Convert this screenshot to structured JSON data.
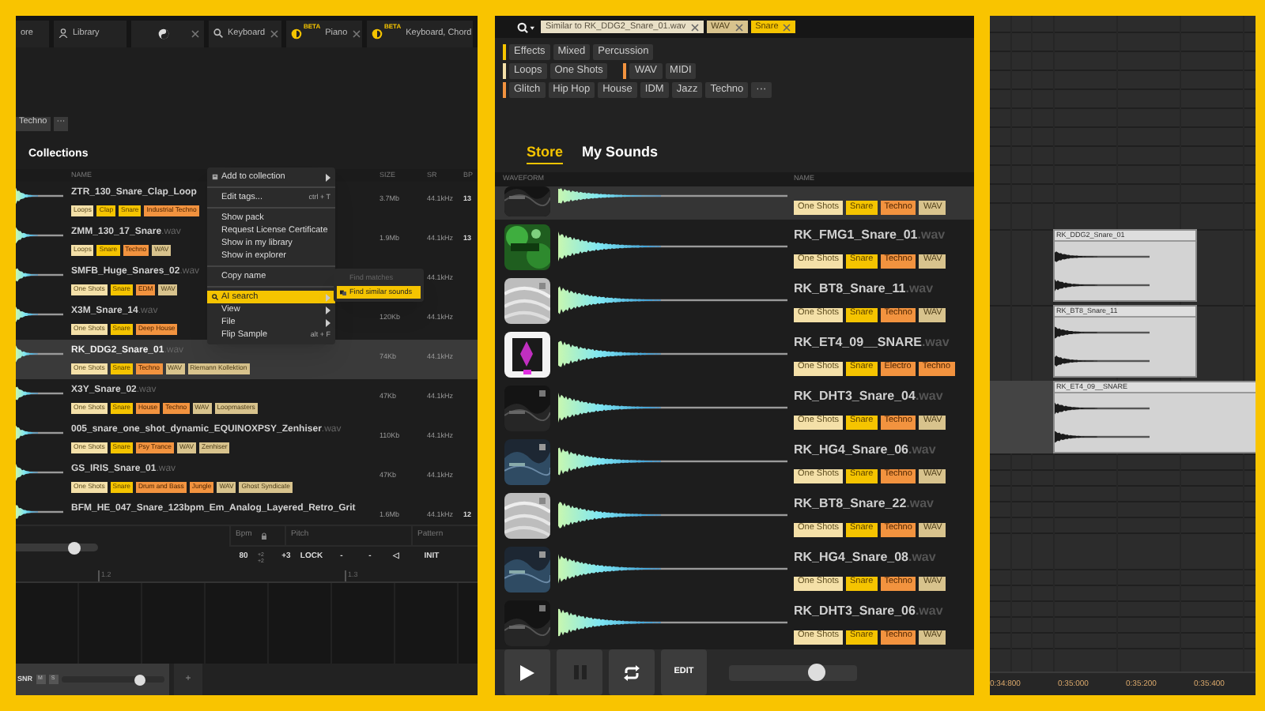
{
  "library_panel": {
    "tabs": [
      {
        "label": "ore",
        "closable": false
      },
      {
        "label": "Library",
        "closable": false
      },
      {
        "closable": true
      },
      {
        "label": "Keyboard",
        "closable": true
      },
      {
        "badge": "BETA",
        "label": "Piano",
        "closable": true
      },
      {
        "badge": "BETA",
        "label": "Keyboard, Chord"
      }
    ],
    "filter_tags": [
      "Techno",
      "···"
    ],
    "heading": "Collections",
    "columns": [
      "NAME",
      "SIZE",
      "SR",
      "BP"
    ],
    "rows": [
      {
        "name": "ZTR_130_Snare_Clap_Loop",
        "selected": false,
        "size": "3.7Mb",
        "sr": "44.1kHz",
        "bpm": "13",
        "tags": [
          {
            "label": "Loops",
            "kind": "type"
          },
          {
            "label": "Clap",
            "kind": "instrument"
          },
          {
            "label": "Snare",
            "kind": "instrument"
          },
          {
            "label": "Industrial Techno",
            "kind": "genre"
          }
        ]
      },
      {
        "name": "ZMM_130_17_Snare",
        "ext": ".wav",
        "selected": false,
        "size": "1.9Mb",
        "sr": "44.1kHz",
        "bpm": "13",
        "tags": [
          {
            "label": "Loops",
            "kind": "type"
          },
          {
            "label": "Snare",
            "kind": "instrument"
          },
          {
            "label": "Techno",
            "kind": "genre"
          },
          {
            "label": "WAV",
            "kind": "meta"
          }
        ]
      },
      {
        "name": "SMFB_Huge_Snares_02",
        "ext": ".wav",
        "selected": false,
        "sr": "44.1kHz",
        "tags": [
          {
            "label": "One Shots",
            "kind": "type"
          },
          {
            "label": "Snare",
            "kind": "instrument"
          },
          {
            "label": "EDM",
            "kind": "genre"
          },
          {
            "label": "WAV",
            "kind": "meta"
          }
        ]
      },
      {
        "name": "X3M_Snare_14",
        "ext": ".wav",
        "selected": false,
        "size": "120Kb",
        "sr": "44.1kHz",
        "tags": [
          {
            "label": "One Shots",
            "kind": "type"
          },
          {
            "label": "Snare",
            "kind": "instrument"
          },
          {
            "label": "Deep House",
            "kind": "genre"
          }
        ]
      },
      {
        "name": "RK_DDG2_Snare_01",
        "ext": ".wav",
        "selected": true,
        "size": "74Kb",
        "sr": "44.1kHz",
        "tags": [
          {
            "label": "One Shots",
            "kind": "type"
          },
          {
            "label": "Snare",
            "kind": "instrument"
          },
          {
            "label": "Techno",
            "kind": "genre"
          },
          {
            "label": "WAV",
            "kind": "meta"
          },
          {
            "label": "Riemann Kollektion",
            "kind": "meta"
          }
        ]
      },
      {
        "name": "X3Y_Snare_02",
        "ext": ".wav",
        "selected": false,
        "size": "47Kb",
        "sr": "44.1kHz",
        "tags": [
          {
            "label": "One Shots",
            "kind": "type"
          },
          {
            "label": "Snare",
            "kind": "instrument"
          },
          {
            "label": "House",
            "kind": "genre"
          },
          {
            "label": "Techno",
            "kind": "genre"
          },
          {
            "label": "WAV",
            "kind": "meta"
          },
          {
            "label": "Loopmasters",
            "kind": "meta"
          }
        ]
      },
      {
        "name": "005_snare_one_shot_dynamic_EQUINOXPSY_Zenhiser",
        "ext": ".wav",
        "selected": false,
        "size": "110Kb",
        "sr": "44.1kHz",
        "tags": [
          {
            "label": "One Shots",
            "kind": "type"
          },
          {
            "label": "Snare",
            "kind": "instrument"
          },
          {
            "label": "Psy Trance",
            "kind": "genre"
          },
          {
            "label": "WAV",
            "kind": "meta"
          },
          {
            "label": "Zenhiser",
            "kind": "meta"
          }
        ]
      },
      {
        "name": "GS_IRIS_Snare_01",
        "ext": ".wav",
        "selected": false,
        "size": "47Kb",
        "sr": "44.1kHz",
        "tags": [
          {
            "label": "One Shots",
            "kind": "type"
          },
          {
            "label": "Snare",
            "kind": "instrument"
          },
          {
            "label": "Drum and Bass",
            "kind": "genre"
          },
          {
            "label": "Jungle",
            "kind": "genre"
          },
          {
            "label": "WAV",
            "kind": "meta"
          },
          {
            "label": "Ghost Syndicate",
            "kind": "meta"
          }
        ]
      },
      {
        "name": "BFM_HE_047_Snare_123bpm_Em_Analog_Layered_Retro_Grit",
        "selected": false,
        "size": "1.6Mb",
        "sr": "44.1kHz",
        "bpm": "12"
      }
    ],
    "context_menu": [
      {
        "kind": "item",
        "label": "Add to collection",
        "submenu": true,
        "highlighted": false
      },
      {
        "kind": "separator"
      },
      {
        "kind": "item",
        "label": "Edit tags...",
        "shortcut": "ctrl + T",
        "submenu": false,
        "highlighted": false
      },
      {
        "kind": "separator"
      },
      {
        "kind": "item",
        "label": "Show pack",
        "submenu": false,
        "highlighted": false
      },
      {
        "kind": "item",
        "label": "Request License Certificate",
        "submenu": false,
        "highlighted": false
      },
      {
        "kind": "item",
        "label": "Show in my library",
        "submenu": false,
        "highlighted": false
      },
      {
        "kind": "item",
        "label": "Show in explorer",
        "submenu": false,
        "highlighted": false
      },
      {
        "kind": "separator"
      },
      {
        "kind": "item",
        "label": "Copy name",
        "submenu": false,
        "highlighted": false
      },
      {
        "kind": "separator"
      },
      {
        "kind": "item",
        "label": "AI search",
        "submenu": true,
        "highlighted": true,
        "open_submenu": [
          {
            "label": "Find matches",
            "disabled": true,
            "highlighted": false
          },
          {
            "label": "Find similar sounds",
            "disabled": false,
            "highlighted": true
          }
        ]
      },
      {
        "kind": "item",
        "label": "View",
        "submenu": true,
        "highlighted": false
      },
      {
        "kind": "item",
        "label": "File",
        "submenu": true,
        "highlighted": false
      },
      {
        "kind": "item",
        "label": "Flip Sample",
        "shortcut": "alt + F",
        "submenu": false,
        "highlighted": false
      }
    ],
    "playback": {
      "slider": {
        "level": 0.72
      },
      "headers": [
        {
          "label": "Bpm"
        },
        {
          "label": "Pitch"
        },
        {
          "label": "Pattern"
        }
      ],
      "bpm": "80",
      "pitch_steps": [
        "+2",
        "+2"
      ],
      "pitch": "+3",
      "buttons": [
        "LOCK",
        "-",
        "-",
        "◁",
        "INIT"
      ]
    },
    "ruler": [
      "1.2",
      "1.3"
    ],
    "track": {
      "name": "SNR",
      "buttons": [
        "M",
        "S"
      ],
      "level": 0.76
    },
    "add_button": "+"
  },
  "browser_panel": {
    "search_chips": [
      {
        "label": "Similar to RK_DDG2_Snare_01.wav",
        "kind": "similar"
      },
      {
        "label": "WAV",
        "kind": "meta"
      },
      {
        "label": "Snare",
        "kind": "instrument"
      }
    ],
    "filter_rows": [
      [
        {
          "color": "#f5c400",
          "items": [
            "Effects",
            "Mixed",
            "Percussion"
          ]
        }
      ],
      [
        {
          "color": "#f4e0a8",
          "items": [
            "Loops",
            "One Shots"
          ]
        },
        {
          "color": "#f2933f",
          "items": [
            "WAV",
            "MIDI"
          ]
        }
      ],
      [
        {
          "color": "#f2933f",
          "items": [
            "Glitch",
            "Hip Hop",
            "House",
            "IDM",
            "Jazz",
            "Techno",
            "···"
          ]
        }
      ]
    ],
    "tabs": [
      {
        "label": "Store",
        "selected": true
      },
      {
        "label": "My Sounds",
        "selected": false
      }
    ],
    "columns": [
      "WAVEFORM",
      "NAME"
    ],
    "rows": [
      {
        "selected": true,
        "tags": [
          {
            "label": "One Shots",
            "kind": "type"
          },
          {
            "label": "Snare",
            "kind": "instrument"
          },
          {
            "label": "Techno",
            "kind": "genre"
          },
          {
            "label": "WAV",
            "kind": "meta"
          }
        ]
      },
      {
        "name": "RK_FMG1_Snare_01",
        "ext": ".wav",
        "selected": false,
        "tags": [
          {
            "label": "One Shots",
            "kind": "type"
          },
          {
            "label": "Snare",
            "kind": "instrument"
          },
          {
            "label": "Techno",
            "kind": "genre"
          },
          {
            "label": "WAV",
            "kind": "meta"
          }
        ]
      },
      {
        "name": "RK_BT8_Snare_11",
        "ext": ".wav",
        "selected": false,
        "tags": [
          {
            "label": "One Shots",
            "kind": "type"
          },
          {
            "label": "Snare",
            "kind": "instrument"
          },
          {
            "label": "Techno",
            "kind": "genre"
          },
          {
            "label": "WAV",
            "kind": "meta"
          }
        ]
      },
      {
        "name": "RK_ET4_09__SNARE",
        "ext": ".wav",
        "selected": false,
        "tags": [
          {
            "label": "One Shots",
            "kind": "type"
          },
          {
            "label": "Snare",
            "kind": "instrument"
          },
          {
            "label": "Electro",
            "kind": "genre"
          },
          {
            "label": "Techno",
            "kind": "genre"
          }
        ]
      },
      {
        "name": "RK_DHT3_Snare_04",
        "ext": ".wav",
        "selected": false,
        "tags": [
          {
            "label": "One Shots",
            "kind": "type"
          },
          {
            "label": "Snare",
            "kind": "instrument"
          },
          {
            "label": "Techno",
            "kind": "genre"
          },
          {
            "label": "WAV",
            "kind": "meta"
          }
        ]
      },
      {
        "name": "RK_HG4_Snare_06",
        "ext": ".wav",
        "selected": false,
        "tags": [
          {
            "label": "One Shots",
            "kind": "type"
          },
          {
            "label": "Snare",
            "kind": "instrument"
          },
          {
            "label": "Techno",
            "kind": "genre"
          },
          {
            "label": "WAV",
            "kind": "meta"
          }
        ]
      },
      {
        "name": "RK_BT8_Snare_22",
        "ext": ".wav",
        "selected": false,
        "tags": [
          {
            "label": "One Shots",
            "kind": "type"
          },
          {
            "label": "Snare",
            "kind": "instrument"
          },
          {
            "label": "Techno",
            "kind": "genre"
          },
          {
            "label": "WAV",
            "kind": "meta"
          }
        ]
      },
      {
        "name": "RK_HG4_Snare_08",
        "ext": ".wav",
        "selected": false,
        "tags": [
          {
            "label": "One Shots",
            "kind": "type"
          },
          {
            "label": "Snare",
            "kind": "instrument"
          },
          {
            "label": "Techno",
            "kind": "genre"
          },
          {
            "label": "WAV",
            "kind": "meta"
          }
        ]
      },
      {
        "name": "RK_DHT3_Snare_06",
        "ext": ".wav",
        "selected": false,
        "tags": [
          {
            "label": "One Shots",
            "kind": "type"
          },
          {
            "label": "Snare",
            "kind": "instrument"
          },
          {
            "label": "Techno",
            "kind": "genre"
          },
          {
            "label": "WAV",
            "kind": "meta"
          }
        ]
      }
    ],
    "transport": {
      "buttons": [
        {
          "kind": "play"
        },
        {
          "kind": "pause"
        },
        {
          "kind": "loop"
        },
        {
          "kind": "text",
          "label": "EDIT"
        }
      ],
      "volume": {
        "level": 0.68
      }
    }
  },
  "arrangement_panel": {
    "clips": [
      {
        "label": "RK_DDG2_Snare_01"
      },
      {
        "label": "RK_BT8_Snare_11"
      },
      {
        "label": "RK_ET4_09__SNARE"
      }
    ],
    "ruler": [
      "0:34:800",
      "0:35:000",
      "0:35:200",
      "0:35:400"
    ]
  }
}
